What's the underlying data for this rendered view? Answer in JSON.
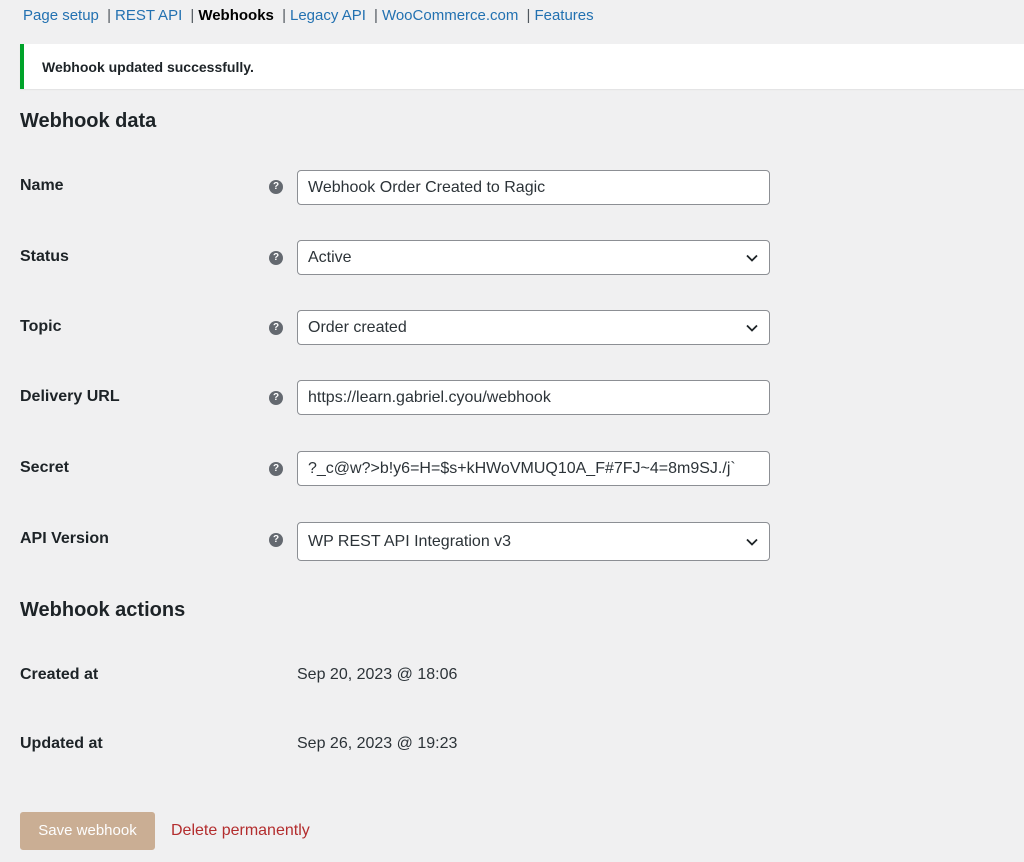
{
  "subnav": {
    "items": [
      {
        "label": "Page setup",
        "current": false
      },
      {
        "label": "REST API",
        "current": false
      },
      {
        "label": "Webhooks",
        "current": true
      },
      {
        "label": "Legacy API",
        "current": false
      },
      {
        "label": "WooCommerce.com",
        "current": false
      },
      {
        "label": "Features",
        "current": false
      }
    ]
  },
  "notice": {
    "text": "Webhook updated successfully.",
    "color": "#00a32a"
  },
  "webhook_data": {
    "heading": "Webhook data",
    "name": {
      "label": "Name",
      "value": "Webhook Order Created to Ragic"
    },
    "status": {
      "label": "Status",
      "value": "Active"
    },
    "topic": {
      "label": "Topic",
      "value": "Order created"
    },
    "delivery_url": {
      "label": "Delivery URL",
      "value": "https://learn.gabriel.cyou/webhook"
    },
    "secret": {
      "label": "Secret",
      "value": "?_c@w?>b!y6=H=$s+kHWoVMUQ10A_F#7FJ~4=8m9SJ./j`"
    },
    "api_version": {
      "label": "API Version",
      "value": "WP REST API Integration v3"
    },
    "help_icon": "?"
  },
  "webhook_actions": {
    "heading": "Webhook actions",
    "created": {
      "label": "Created at",
      "value": "Sep 20, 2023 @ 18:06"
    },
    "updated": {
      "label": "Updated at",
      "value": "Sep 26, 2023 @ 19:23"
    }
  },
  "actions": {
    "save_label": "Save webhook",
    "delete_label": "Delete permanently"
  }
}
